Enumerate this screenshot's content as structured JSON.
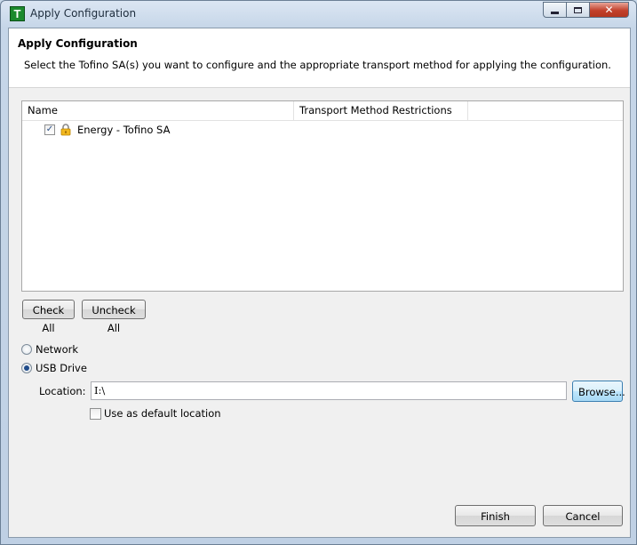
{
  "window": {
    "title": "Apply Configuration",
    "app_icon_letter": "T",
    "controls": {
      "close_glyph": "✕"
    }
  },
  "header": {
    "title": "Apply Configuration",
    "description": "Select the Tofino SA(s) you want to configure and the appropriate transport method for applying the configuration."
  },
  "table": {
    "columns": [
      "Name",
      "Transport Method Restrictions"
    ],
    "rows": [
      {
        "label": "Energy - Tofino SA",
        "checked": true,
        "checkmark": "✓",
        "icon": "lock-icon"
      }
    ]
  },
  "buttons": {
    "check_all": "Check All",
    "uncheck_all": "Uncheck All",
    "browse": "Browse...",
    "finish": "Finish",
    "cancel": "Cancel"
  },
  "transport": {
    "network_label": "Network",
    "usb_label": "USB Drive",
    "selected": "USB Drive",
    "location_label": "Location:",
    "location_value": "I:\\",
    "default_checkbox_label": "Use as default location",
    "default_checked": false
  },
  "colors": {
    "title_bar": "#c6d6e8",
    "close_button": "#c2402b",
    "app_icon": "#1b8a2d",
    "selected_radio": "#1f4b8a"
  }
}
